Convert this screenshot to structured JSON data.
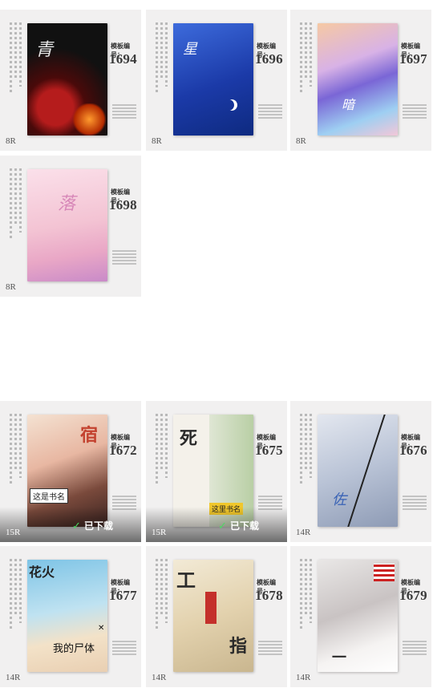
{
  "label_text": "模板编号：",
  "downloaded_text": "已下载",
  "cards": [
    {
      "number": "1694",
      "size": "8R"
    },
    {
      "number": "1696",
      "size": "8R"
    },
    {
      "number": "1697",
      "size": "8R"
    },
    {
      "number": "1698",
      "size": "8R"
    },
    {
      "number": "1672",
      "size": "15R",
      "downloaded": true,
      "cover_text": "这是书名"
    },
    {
      "number": "1675",
      "size": "15R",
      "downloaded": true,
      "cover_text": "这里书名"
    },
    {
      "number": "1676",
      "size": "14R"
    },
    {
      "number": "1677",
      "size": "14R",
      "cover_text_top": "花火",
      "cover_text_bottom": "我的尸体"
    },
    {
      "number": "1678",
      "size": "14R"
    },
    {
      "number": "1679",
      "size": "14R"
    }
  ],
  "icons": {
    "check": "checkmark-icon"
  },
  "colors": {
    "card_bg": "#f1f0f0",
    "download_check": "#4cd964"
  }
}
